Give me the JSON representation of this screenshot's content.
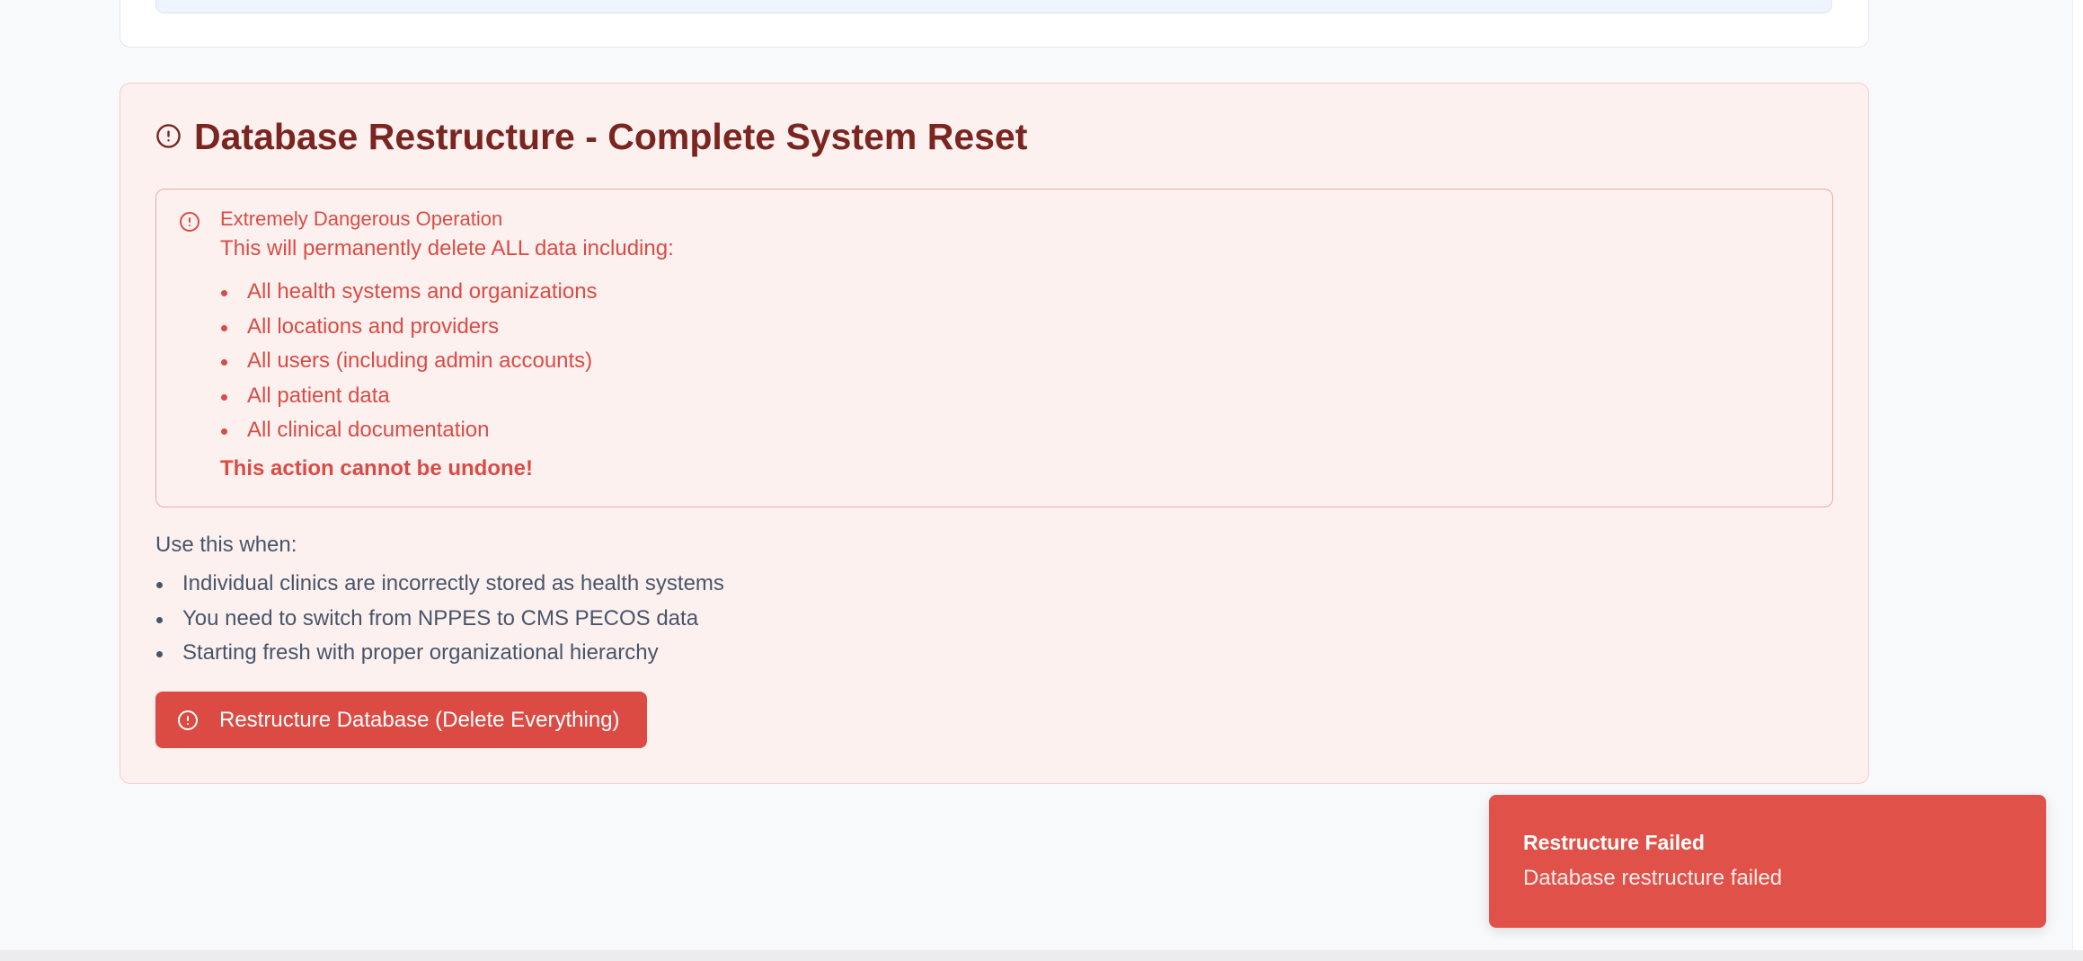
{
  "restructure_section": {
    "title": "Database Restructure - Complete System Reset",
    "alert": {
      "title": "Extremely Dangerous Operation",
      "intro": "This will permanently delete ALL data including:",
      "items": [
        "All health systems and organizations",
        "All locations and providers",
        "All users (including admin accounts)",
        "All patient data",
        "All clinical documentation"
      ],
      "warning": "This action cannot be undone!"
    },
    "use_when": {
      "heading": "Use this when:",
      "items": [
        "Individual clinics are incorrectly stored as health systems",
        "You need to switch from NPPES to CMS PECOS data",
        "Starting fresh with proper organizational hierarchy"
      ]
    },
    "button_label": "Restructure Database (Delete Everything)"
  },
  "toast": {
    "title": "Restructure Failed",
    "description": "Database restructure failed"
  },
  "colors": {
    "danger_text": "#d94c45",
    "title_text": "#7a2520",
    "button_bg": "#db4b44",
    "toast_bg": "#e05249",
    "card_bg": "#fdf1f0"
  },
  "icons": {
    "title_icon": "alert-circle-icon",
    "alert_icon": "alert-circle-icon",
    "button_icon": "alert-circle-icon"
  }
}
